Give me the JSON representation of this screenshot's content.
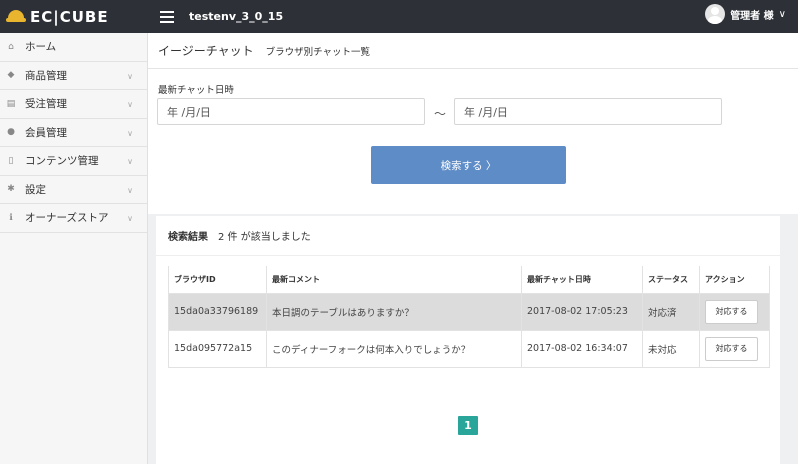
{
  "header": {
    "logo_text": "EC|CUBE",
    "site_name": "testenv_3_0_15",
    "user_label": "管理者 様",
    "user_chevron": "∨"
  },
  "sidebar": {
    "items": [
      {
        "label": "ホーム",
        "icon": "home-icon",
        "glyph": "⌂"
      },
      {
        "label": "商品管理",
        "icon": "tag-icon",
        "glyph": "◆"
      },
      {
        "label": "受注管理",
        "icon": "cart-icon",
        "glyph": "▤"
      },
      {
        "label": "会員管理",
        "icon": "users-icon",
        "glyph": "●"
      },
      {
        "label": "コンテンツ管理",
        "icon": "file-icon",
        "glyph": "▯"
      },
      {
        "label": "設定",
        "icon": "gear-icon",
        "glyph": "✱"
      },
      {
        "label": "オーナーズストア",
        "icon": "info-icon",
        "glyph": "ℹ"
      }
    ],
    "chevron": "∨"
  },
  "page": {
    "title": "イージーチャット",
    "subtitle": "ブラウザ別チャット一覧"
  },
  "search": {
    "label": "最新チャット日時",
    "date_from_placeholder": "年 /月/日",
    "date_to_placeholder": "年 /月/日",
    "separator": "～",
    "button_label": "検索する 〉"
  },
  "results": {
    "heading": "検索結果",
    "summary": "2 件 が該当しました",
    "columns": [
      "ブラウザID",
      "最新コメント",
      "最新チャット日時",
      "ステータス",
      "アクション"
    ],
    "rows": [
      {
        "browser_id": "15da0a33796189",
        "comment": "本日調のテーブルはありますか？",
        "datetime": "2017-08-02 17:05:23",
        "status": "対応済",
        "action": "対応する"
      },
      {
        "browser_id": "15da095772a15",
        "comment": "このディナーフォークは何本入りでしょうか？",
        "datetime": "2017-08-02 16:34:07",
        "status": "未対応",
        "action": "対応する"
      }
    ]
  },
  "pagination": {
    "current_page": "1"
  },
  "colors": {
    "topbar": "#2d3037",
    "primary_button": "#5e8cc7",
    "pager": "#2aa59a",
    "logo_accent": "#e9b52f"
  }
}
